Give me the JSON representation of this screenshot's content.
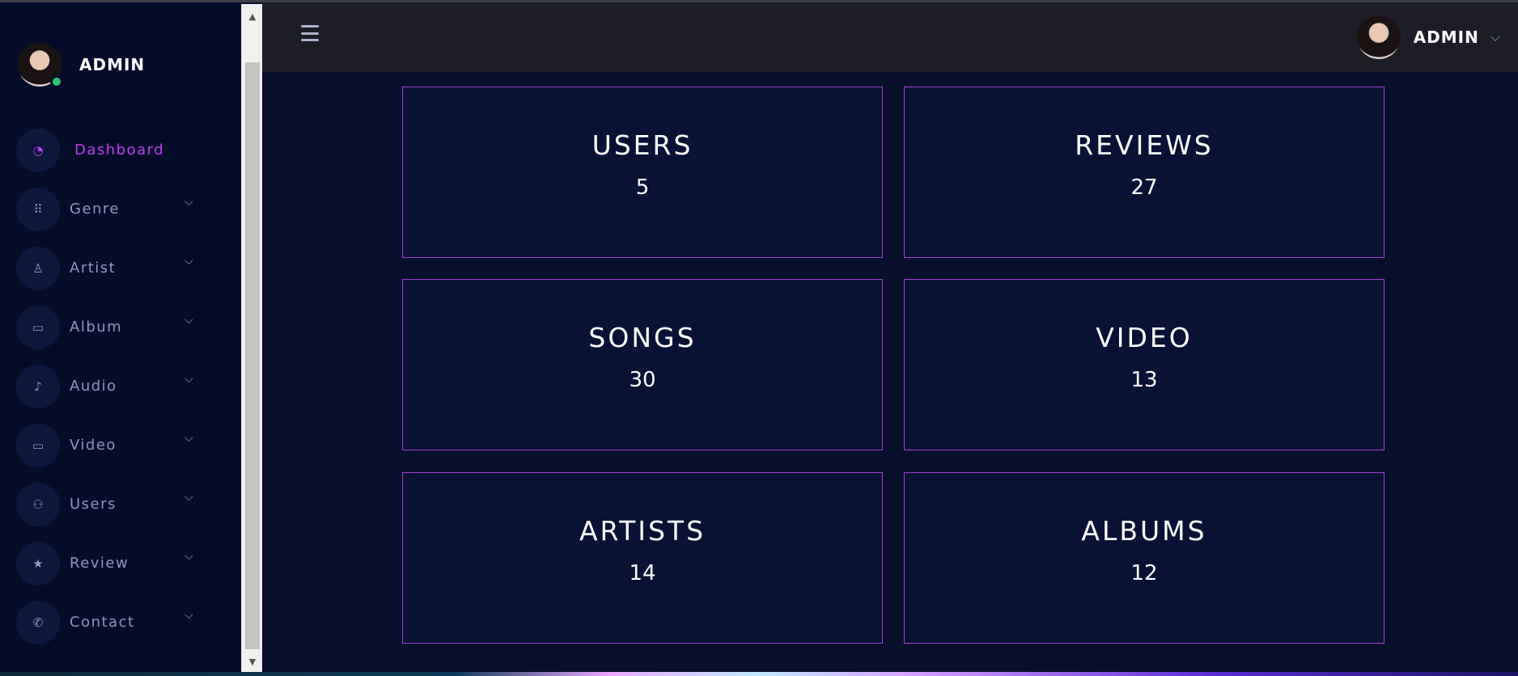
{
  "sidebar": {
    "profile_name": "ADMIN",
    "items": [
      {
        "label": "Dashboard",
        "icon": "dashboard-icon",
        "glyph": "◔"
      },
      {
        "label": "Genre",
        "icon": "grid-icon",
        "glyph": "⠿"
      },
      {
        "label": "Artist",
        "icon": "user-icon",
        "glyph": "♙"
      },
      {
        "label": "Album",
        "icon": "folder-icon",
        "glyph": "▭"
      },
      {
        "label": "Audio",
        "icon": "music-note-icon",
        "glyph": "♪"
      },
      {
        "label": "Video",
        "icon": "video-camera-icon",
        "glyph": "▭"
      },
      {
        "label": "Users",
        "icon": "users-icon",
        "glyph": "⚇"
      },
      {
        "label": "Review",
        "icon": "star-icon",
        "glyph": "★"
      },
      {
        "label": "Contact",
        "icon": "phone-icon",
        "glyph": "✆"
      }
    ],
    "active_color": "#c23bf0"
  },
  "header": {
    "user_name": "ADMIN"
  },
  "stats": [
    {
      "title": "USERS",
      "value": "5"
    },
    {
      "title": "REVIEWS",
      "value": "27"
    },
    {
      "title": "SONGS",
      "value": "30"
    },
    {
      "title": "VIDEO",
      "value": "13"
    },
    {
      "title": "ARTISTS",
      "value": "14"
    },
    {
      "title": "ALBUMS",
      "value": "12"
    }
  ],
  "colors": {
    "background": "#080f2c",
    "card_border": "#a33fd6",
    "header_bg": "#1c1d27"
  }
}
